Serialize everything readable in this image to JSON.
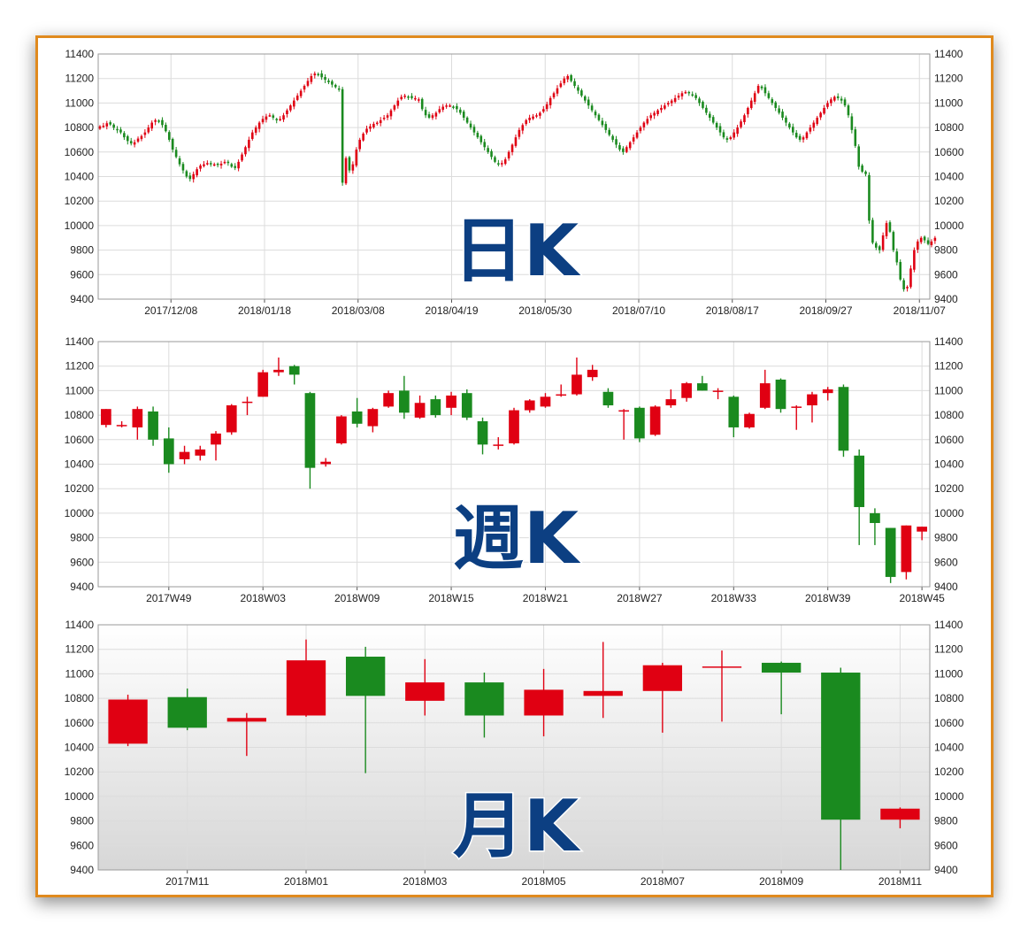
{
  "colors": {
    "up": "#e00012",
    "down": "#1a8a1f",
    "frame": "#e08a1e",
    "label": "#0c3f82",
    "grid": "#dcdcdc"
  },
  "chart_data": [
    {
      "type": "candlestick",
      "label": "日K",
      "ylim": [
        9400,
        11400
      ],
      "yticks": [
        9400,
        9600,
        9800,
        10000,
        10200,
        10400,
        10600,
        10800,
        11000,
        11200,
        11400
      ],
      "x_tick_labels": [
        "2017/12/08",
        "2018/01/18",
        "2018/03/08",
        "2018/04/19",
        "2018/05/30",
        "2018/07/10",
        "2018/08/17",
        "2018/09/27",
        "2018/11/07"
      ],
      "x_tick_positions": [
        21,
        48,
        75,
        102,
        129,
        156,
        183,
        210,
        237
      ],
      "n": 240,
      "close": [
        10810,
        10815,
        10835,
        10825,
        10798,
        10780,
        10760,
        10720,
        10690,
        10670,
        10680,
        10710,
        10730,
        10760,
        10800,
        10840,
        10860,
        10850,
        10820,
        10770,
        10700,
        10620,
        10560,
        10500,
        10450,
        10400,
        10380,
        10420,
        10460,
        10490,
        10500,
        10510,
        10505,
        10500,
        10495,
        10505,
        10520,
        10510,
        10480,
        10470,
        10520,
        10580,
        10640,
        10700,
        10760,
        10800,
        10840,
        10870,
        10890,
        10900,
        10880,
        10860,
        10870,
        10900,
        10940,
        10980,
        11020,
        11060,
        11100,
        11140,
        11180,
        11220,
        11240,
        11230,
        11210,
        11190,
        11170,
        11150,
        11130,
        11110,
        10350,
        10550,
        10450,
        10500,
        10620,
        10700,
        10750,
        10790,
        10810,
        10830,
        10840,
        10860,
        10880,
        10900,
        10940,
        10980,
        11020,
        11050,
        11060,
        11050,
        11040,
        11040,
        11030,
        10950,
        10900,
        10880,
        10900,
        10920,
        10950,
        10970,
        10980,
        10980,
        10970,
        10950,
        10920,
        10880,
        10840,
        10800,
        10760,
        10720,
        10680,
        10640,
        10600,
        10560,
        10520,
        10500,
        10510,
        10540,
        10600,
        10660,
        10720,
        10780,
        10820,
        10860,
        10880,
        10890,
        10900,
        10920,
        10950,
        10990,
        11040,
        11080,
        11120,
        11160,
        11200,
        11220,
        11180,
        11140,
        11100,
        11060,
        11020,
        10980,
        10940,
        10900,
        10860,
        10820,
        10780,
        10740,
        10700,
        10660,
        10620,
        10600,
        10640,
        10680,
        10720,
        10760,
        10800,
        10840,
        10870,
        10900,
        10920,
        10940,
        10960,
        10980,
        11000,
        11020,
        11040,
        11060,
        11080,
        11090,
        11080,
        11060,
        11040,
        11000,
        10960,
        10920,
        10880,
        10840,
        10800,
        10760,
        10720,
        10700,
        10720,
        10760,
        10800,
        10850,
        10900,
        10960,
        11020,
        11080,
        11140,
        11120,
        11080,
        11040,
        11000,
        10960,
        10920,
        10880,
        10840,
        10800,
        10760,
        10720,
        10700,
        10720,
        10760,
        10800,
        10840,
        10880,
        10920,
        10960,
        11000,
        11030,
        11050,
        11040,
        11020,
        10980,
        10900,
        10780,
        10650,
        10480,
        10440,
        10420,
        10040,
        9860,
        9820,
        9800,
        9920,
        10020,
        9950,
        9800,
        9700,
        9560,
        9480,
        9500,
        9650,
        9800,
        9870,
        9900,
        9880,
        9850,
        9870,
        9900
      ]
    },
    {
      "type": "candlestick",
      "label": "週K",
      "ylim": [
        9400,
        11400
      ],
      "yticks": [
        9400,
        9600,
        9800,
        10000,
        10200,
        10400,
        10600,
        10800,
        11000,
        11200,
        11400
      ],
      "x_tick_labels": [
        "2017W49",
        "2018W03",
        "2018W09",
        "2018W15",
        "2018W21",
        "2018W27",
        "2018W33",
        "2018W39",
        "2018W45"
      ],
      "x_tick_positions": [
        4.5,
        10.5,
        16.5,
        22.5,
        28.5,
        34.5,
        40.5,
        46.5,
        52.5
      ],
      "n": 53,
      "candles": [
        [
          10720,
          10850,
          10850,
          10700
        ],
        [
          10720,
          10720,
          10750,
          10700
        ],
        [
          10700,
          10850,
          10870,
          10600
        ],
        [
          10830,
          10600,
          10870,
          10550
        ],
        [
          10610,
          10400,
          10700,
          10330
        ],
        [
          10440,
          10500,
          10550,
          10400
        ],
        [
          10470,
          10520,
          10550,
          10430
        ],
        [
          10560,
          10650,
          10670,
          10430
        ],
        [
          10660,
          10880,
          10890,
          10640
        ],
        [
          10900,
          10910,
          10950,
          10800
        ],
        [
          10950,
          11150,
          11170,
          10950
        ],
        [
          11150,
          11170,
          11270,
          11120
        ],
        [
          11200,
          11130,
          11210,
          11050
        ],
        [
          10980,
          10370,
          10990,
          10200
        ],
        [
          10400,
          10420,
          10450,
          10380
        ],
        [
          10570,
          10790,
          10800,
          10560
        ],
        [
          10830,
          10730,
          10940,
          10700
        ],
        [
          10710,
          10850,
          10860,
          10660
        ],
        [
          10870,
          10980,
          11000,
          10860
        ],
        [
          11000,
          10820,
          11120,
          10770
        ],
        [
          10780,
          10900,
          10960,
          10770
        ],
        [
          10930,
          10800,
          10960,
          10780
        ],
        [
          10860,
          10960,
          10990,
          10800
        ],
        [
          10980,
          10780,
          11010,
          10760
        ],
        [
          10750,
          10560,
          10780,
          10480
        ],
        [
          10560,
          10560,
          10620,
          10520
        ],
        [
          10570,
          10840,
          10860,
          10560
        ],
        [
          10840,
          10920,
          10930,
          10820
        ],
        [
          10870,
          10950,
          10980,
          10860
        ],
        [
          10960,
          10970,
          11050,
          10950
        ],
        [
          10970,
          11130,
          11270,
          10960
        ],
        [
          11110,
          11170,
          11210,
          11080
        ],
        [
          10990,
          10880,
          11020,
          10860
        ],
        [
          10840,
          10840,
          10850,
          10600
        ],
        [
          10860,
          10610,
          10870,
          10580
        ],
        [
          10640,
          10870,
          10880,
          10630
        ],
        [
          10880,
          10930,
          11010,
          10860
        ],
        [
          10940,
          11060,
          11070,
          10910
        ],
        [
          11060,
          11000,
          11120,
          11000
        ],
        [
          11000,
          11000,
          11020,
          10930
        ],
        [
          10950,
          10700,
          10960,
          10620
        ],
        [
          10700,
          10810,
          10820,
          10690
        ],
        [
          10860,
          11060,
          11170,
          10850
        ],
        [
          11090,
          10850,
          11100,
          10820
        ],
        [
          10860,
          10870,
          10880,
          10680
        ],
        [
          10880,
          10970,
          10990,
          10740
        ],
        [
          10980,
          11010,
          11030,
          10920
        ],
        [
          11030,
          10510,
          11050,
          10460
        ],
        [
          10470,
          10050,
          10520,
          9740
        ],
        [
          10000,
          9920,
          10040,
          9740
        ],
        [
          9880,
          9480,
          9880,
          9430
        ],
        [
          9520,
          9900,
          9900,
          9460
        ],
        [
          9850,
          9890,
          9890,
          9780
        ]
      ]
    },
    {
      "type": "candlestick",
      "label": "月K",
      "ylim": [
        9400,
        11400
      ],
      "yticks": [
        9400,
        9600,
        9800,
        10000,
        10200,
        10400,
        10600,
        10800,
        11000,
        11200,
        11400
      ],
      "x_tick_labels": [
        "2017M11",
        "2018M01",
        "2018M03",
        "2018M05",
        "2018M07",
        "2018M09",
        "2018M11"
      ],
      "x_tick_positions": [
        1.5,
        3.5,
        5.5,
        7.5,
        9.5,
        11.5,
        13.5
      ],
      "n": 14,
      "candles": [
        [
          10430,
          10790,
          10830,
          10410
        ],
        [
          10810,
          10560,
          10880,
          10540
        ],
        [
          10610,
          10640,
          10680,
          10330
        ],
        [
          10660,
          11110,
          11280,
          10650
        ],
        [
          11140,
          10820,
          11220,
          10190
        ],
        [
          10780,
          10930,
          11120,
          10660
        ],
        [
          10930,
          10660,
          11010,
          10480
        ],
        [
          10660,
          10870,
          11040,
          10490
        ],
        [
          10820,
          10860,
          11260,
          10640
        ],
        [
          10860,
          11070,
          11090,
          10520
        ],
        [
          11060,
          11060,
          11190,
          10610
        ],
        [
          11090,
          11010,
          11100,
          10670
        ],
        [
          11010,
          9810,
          11050,
          9400
        ],
        [
          9810,
          9900,
          9910,
          9740
        ]
      ]
    }
  ]
}
